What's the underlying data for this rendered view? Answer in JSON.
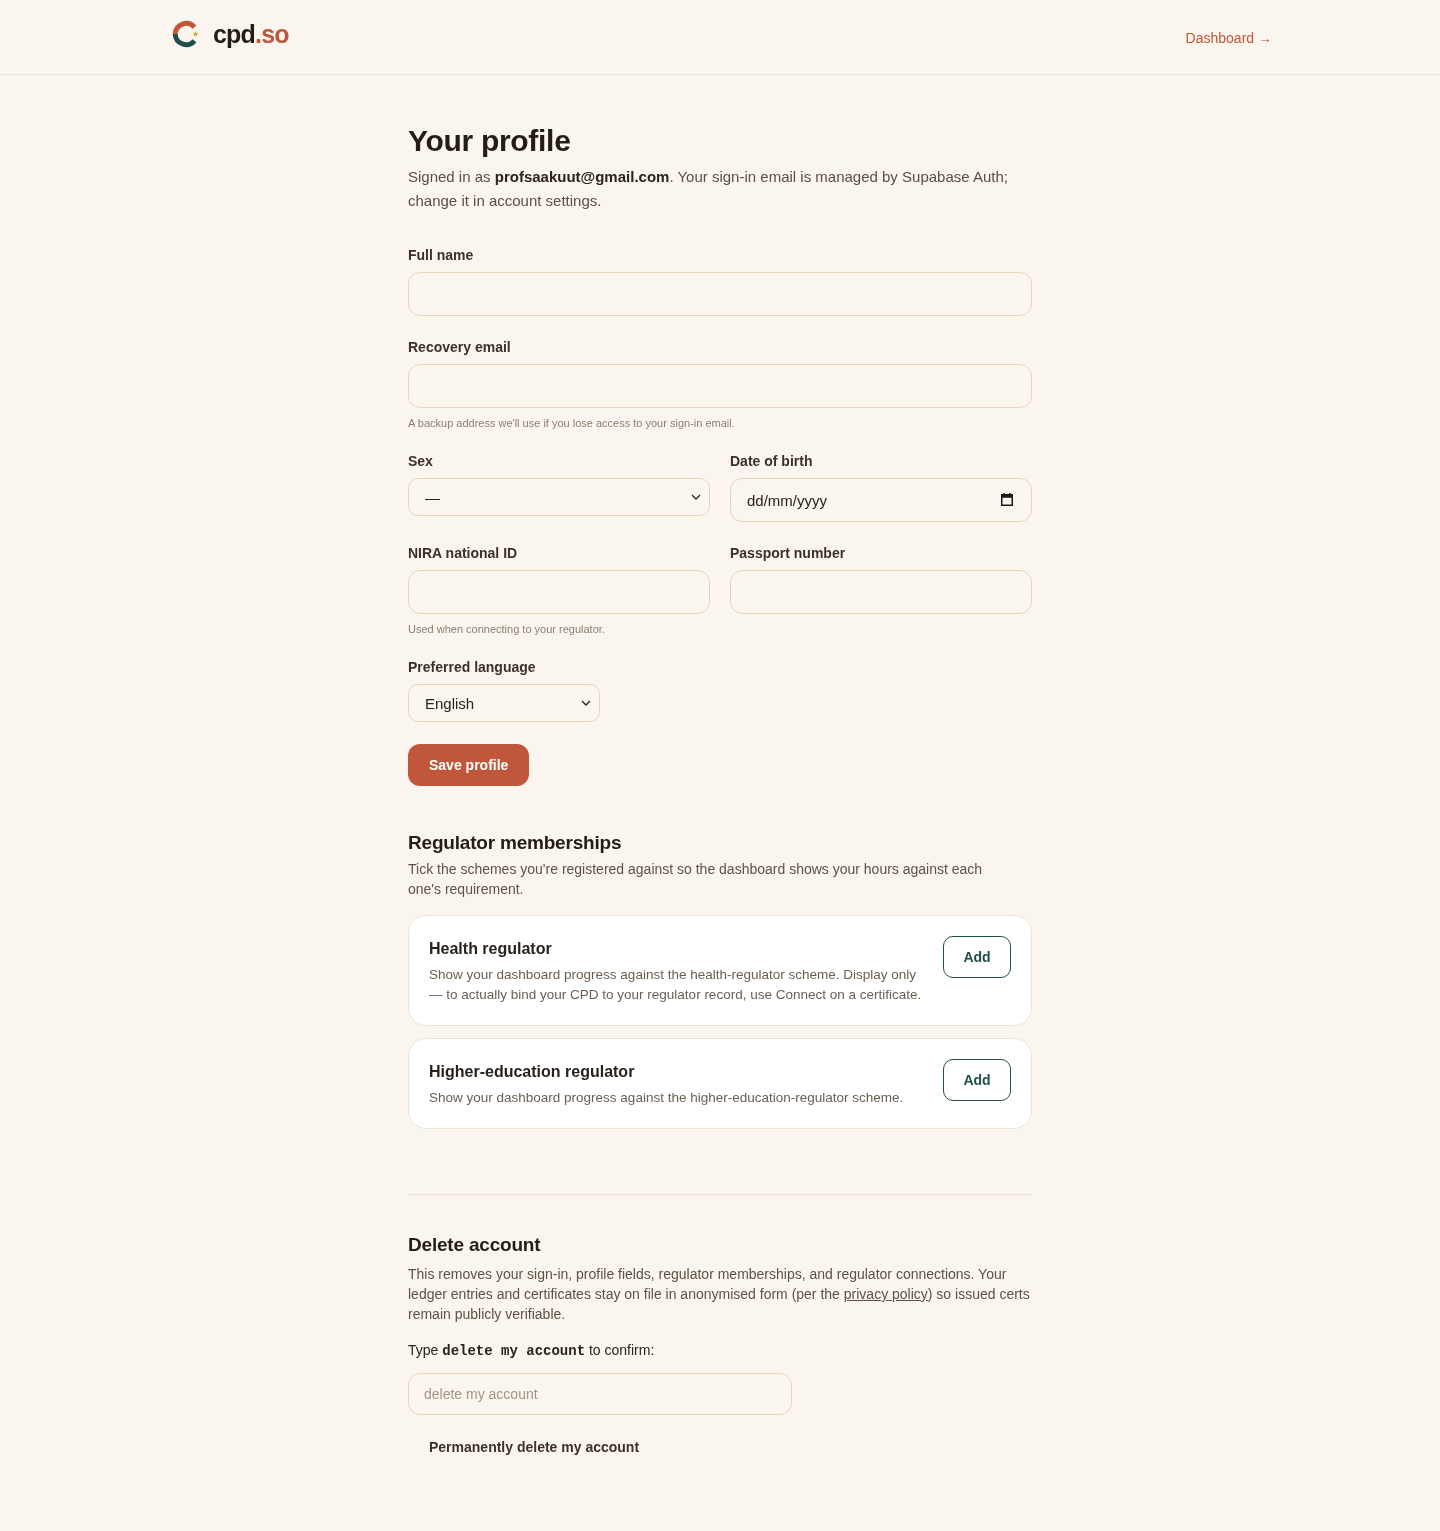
{
  "header": {
    "logo": {
      "name": "cpd",
      "suffix": ".so"
    },
    "dashboard_link": "Dashboard →"
  },
  "profile": {
    "title": "Your profile",
    "intro": "Signed in as **profsaakuut@gmail.com**. Your sign-in email is managed by Supabase Auth; change it in account settings.",
    "rows": [
      [
        {
          "kind": "text",
          "label": "Full name"
        }
      ],
      [
        {
          "kind": "text",
          "label": "Recovery email",
          "hint": "A backup address we'll use if you lose access to your sign-in email."
        }
      ],
      [
        {
          "kind": "select",
          "label": "Sex",
          "value": "—"
        },
        {
          "kind": "date",
          "label": "Date of birth",
          "placeholder": "dd/mm/yyyy"
        }
      ],
      [
        {
          "kind": "text",
          "label": "NIRA national ID",
          "hint": "Used when connecting to your regulator."
        },
        {
          "kind": "text",
          "label": "Passport number"
        }
      ]
    ],
    "preferred_language": {
      "label": "Preferred language",
      "value": "English"
    },
    "save_button": "Save profile"
  },
  "regulator_memberships": {
    "title": "Regulator memberships",
    "description": "Tick the schemes you're registered against so the dashboard shows your hours against each one's requirement.",
    "schemes": [
      {
        "name": "Health regulator",
        "description": "Show your dashboard progress against the health-regulator scheme. Display only — to actually bind your CPD to your regulator record, use Connect on a certificate.",
        "button": "Add"
      },
      {
        "name": "Higher-education regulator",
        "description": "Show your dashboard progress against the higher-education-regulator scheme.",
        "button": "Add"
      }
    ]
  },
  "delete_account": {
    "title": "Delete account",
    "description": {
      "before": "This removes your sign-in, profile fields, regulator memberships, and regulator connections. Your ledger entries and certificates stay on file in anonymised form (per the ",
      "link": "privacy policy",
      "after": ") so issued certs remain publicly verifiable."
    },
    "confirm_label": "Type **delete my account** to confirm:",
    "confirm_placeholder": "delete my account",
    "delete_button": "Permanently delete my account"
  }
}
